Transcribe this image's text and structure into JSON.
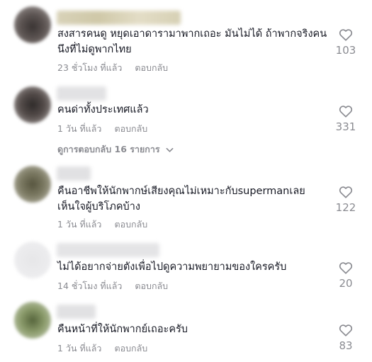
{
  "comments": [
    {
      "text": "สงสารคนดู หยุดเอาดารามาพากเถอะ มันไม่ได้ ถ้าพากจริงคนนึงที่ไม่ดูพากไทย",
      "time": "23 ชั่วโมง ที่แล้ว",
      "reply_label": "ตอบกลับ",
      "likes": "103"
    },
    {
      "text": "คนด่าทั้งประเทศแล้ว",
      "time": "1 วัน ที่แล้ว",
      "reply_label": "ตอบกลับ",
      "likes": "331",
      "view_replies": "ดูการตอบกลับ 16 รายการ"
    },
    {
      "text": "คืนอาชีพให้นักพากษ์เสียงคุณไม่เหมาะกับsupermanเลยเห็นใจผู้บริโภคบ้าง",
      "time": "1 วัน ที่แล้ว",
      "reply_label": "ตอบกลับ",
      "likes": "122"
    },
    {
      "text": "ไม่ได้อยากจ่ายตังเพื่อไปดูความพยายามของใครครับ",
      "time": "14 ชั่วโมง ที่แล้ว",
      "reply_label": "ตอบกลับ",
      "likes": "20"
    },
    {
      "text": "คืนหน้าที่ให้นักพากย์เถอะครับ",
      "time": "1 วัน ที่แล้ว",
      "reply_label": "ตอบกลับ",
      "likes": "83"
    }
  ],
  "colors": {
    "text": "#161823",
    "muted": "#8a8b91"
  },
  "icons": {
    "like": "heart-outline-icon",
    "expand": "chevron-down-icon"
  }
}
